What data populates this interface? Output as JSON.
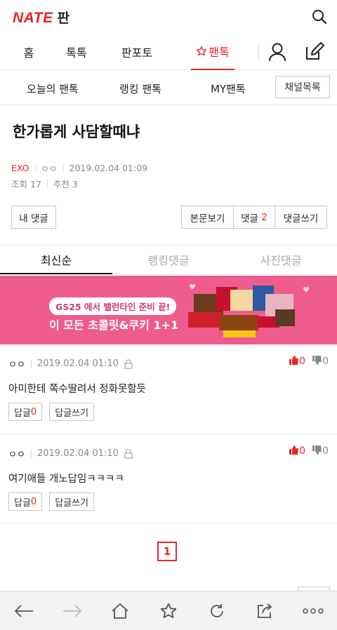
{
  "header": {
    "brand": "NATE",
    "service": "판"
  },
  "gnb": {
    "tabs": [
      {
        "label": "홈"
      },
      {
        "label": "톡톡"
      },
      {
        "label": "판포토"
      },
      {
        "label": "팬톡",
        "active": true
      }
    ]
  },
  "subnav": {
    "items": [
      "오늘의 팬톡",
      "랭킹 팬톡",
      "MY팬톡"
    ],
    "channel_button": "채널목록"
  },
  "post": {
    "title": "한가롭게 사담할때냐",
    "category": "EXO",
    "author": "ㅇㅇ",
    "datetime": "2019.02.04 01:09",
    "views_label": "조회",
    "views": "17",
    "recommend_label": "추천",
    "recommend": "3"
  },
  "actions": {
    "my_comments": "내 댓글",
    "view_body": "본문보기",
    "comments_label": "댓글",
    "comments_count": "2",
    "write_comment": "댓글쓰기"
  },
  "comment_tabs": [
    {
      "label": "최신순",
      "active": true
    },
    {
      "label": "랭킹댓글"
    },
    {
      "label": "사진댓글"
    }
  ],
  "banner": {
    "line1_prefix": "GS25",
    "line1_rest": " 에서 밸런타인 준비 끝!",
    "line2": "이 모든 초콜릿&쿠키 1+1",
    "bg_color": "#ee5c8d"
  },
  "comments": [
    {
      "author": "ㅇㅇ",
      "datetime": "2019.02.04 01:10",
      "up": "0",
      "down": "0",
      "text": "아미한테 쪽수딸려서 정화못할듯",
      "reply_label": "답글",
      "reply_count": "0",
      "write_reply": "답글쓰기"
    },
    {
      "author": "ㅇㅇ",
      "datetime": "2019.02.04 01:10",
      "up": "0",
      "down": "0",
      "text": "여기애들 개노답임ㅋㅋㅋㅋ",
      "reply_label": "답글",
      "reply_count": "0",
      "write_reply": "답글쓰기"
    }
  ],
  "pagination": {
    "current": "1"
  },
  "colors": {
    "accent": "#e52629",
    "banner": "#ee5c8d"
  },
  "browser_bar": {
    "icons": [
      "back-icon",
      "forward-icon",
      "home-icon",
      "bookmark-star-icon",
      "refresh-icon",
      "share-icon",
      "more-icon"
    ]
  }
}
